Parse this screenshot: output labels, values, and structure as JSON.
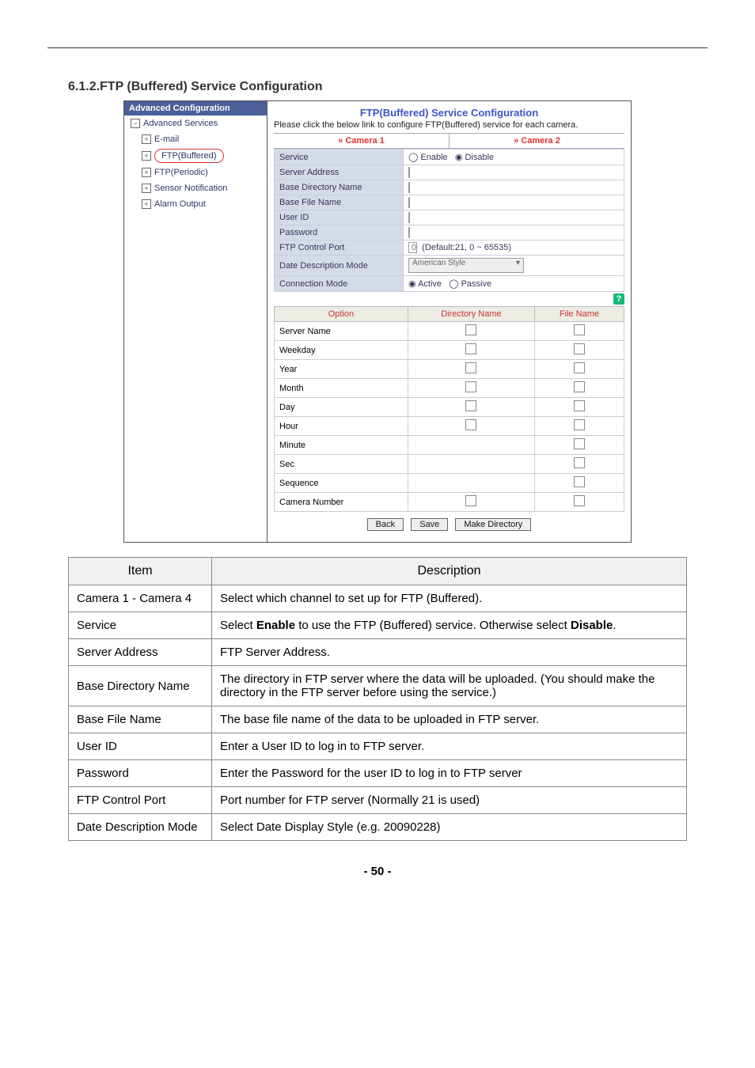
{
  "heading": "6.1.2.FTP (Buffered) Service Configuration",
  "page_number": "- 50 -",
  "nav": {
    "title": "Advanced Configuration",
    "root": "Advanced Services",
    "items": [
      "E-mail",
      "FTP(Buffered)",
      "FTP(Periodic)",
      "Sensor Notification",
      "Alarm Output"
    ]
  },
  "shot": {
    "title": "FTP(Buffered) Service Configuration",
    "intro": "Please click the below link to configure FTP(Buffered) service for each camera.",
    "tabs": [
      "» Camera 1",
      "» Camera 2"
    ],
    "rows": {
      "service": "Service",
      "service_enable": "Enable",
      "service_disable": "Disable",
      "server_address": "Server Address",
      "base_dir": "Base Directory Name",
      "base_file": "Base File Name",
      "user_id": "User ID",
      "password": "Password",
      "ctrl_port": "FTP Control Port",
      "ctrl_port_val": "0",
      "ctrl_port_hint": "(Default:21, 0 ~ 65535)",
      "date_mode": "Date Description Mode",
      "date_mode_val": "American Style",
      "conn_mode": "Connection Mode",
      "conn_active": "Active",
      "conn_passive": "Passive"
    },
    "opt_head": {
      "c1": "Option",
      "c2": "Directory Name",
      "c3": "File Name"
    },
    "opt_rows": [
      {
        "name": "Server Name",
        "dir": true,
        "file": true
      },
      {
        "name": "Weekday",
        "dir": true,
        "file": true
      },
      {
        "name": "Year",
        "dir": true,
        "file": true
      },
      {
        "name": "Month",
        "dir": true,
        "file": true
      },
      {
        "name": "Day",
        "dir": true,
        "file": true
      },
      {
        "name": "Hour",
        "dir": true,
        "file": true
      },
      {
        "name": "Minute",
        "dir": false,
        "file": true
      },
      {
        "name": "Sec",
        "dir": false,
        "file": true
      },
      {
        "name": "Sequence",
        "dir": false,
        "file": true
      },
      {
        "name": "Camera Number",
        "dir": true,
        "file": true
      }
    ],
    "buttons": {
      "back": "Back",
      "save": "Save",
      "mkdir": "Make Directory"
    }
  },
  "table": {
    "head": {
      "item": "Item",
      "desc": "Description"
    },
    "rows": [
      {
        "item": "Camera 1 - Camera 4",
        "desc": "Select which channel to set up for FTP (Buffered)."
      },
      {
        "item": "Service",
        "desc": "Select <b>Enable</b> to use the FTP (Buffered) service. Otherwise select <b>Disable</b>."
      },
      {
        "item": "Server Address",
        "desc": "FTP Server Address."
      },
      {
        "item": "Base Directory Name",
        "desc": "The directory in FTP server where the data will be uploaded. (You should make the directory in the FTP server before using the service.)"
      },
      {
        "item": "Base File Name",
        "desc": "The base file name of the data to be uploaded in FTP server."
      },
      {
        "item": "User ID",
        "desc": "Enter a User ID to log in to FTP server."
      },
      {
        "item": "Password",
        "desc": "Enter the Password for the user ID to log in to FTP server"
      },
      {
        "item": "FTP Control Port",
        "desc": "Port number for FTP server (Normally 21 is used)"
      },
      {
        "item": "Date Description Mode",
        "desc": "Select Date Display Style (e.g. 20090228)"
      }
    ]
  }
}
